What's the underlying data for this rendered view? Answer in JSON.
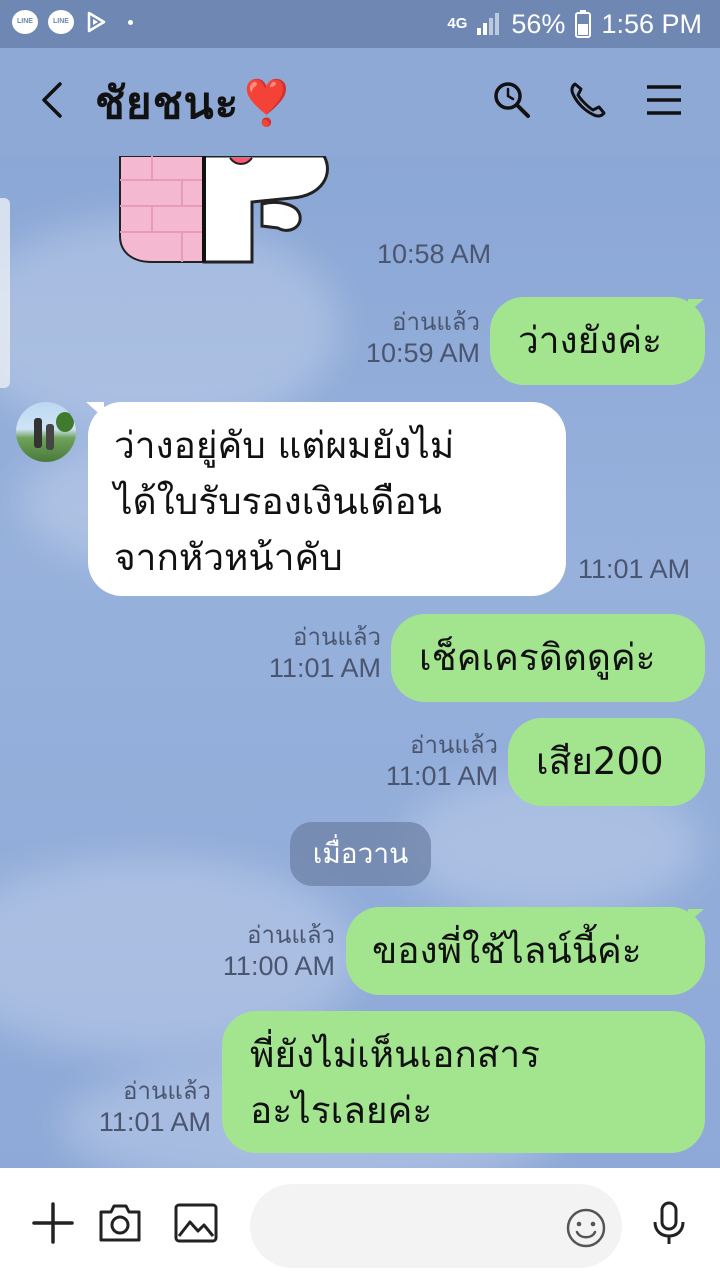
{
  "status_bar": {
    "network": "4G",
    "battery": "56%",
    "clock": "1:56 PM",
    "notif_icons": [
      "LINE",
      "LINE"
    ]
  },
  "header": {
    "title": "ชัยชนะ❣️",
    "icons": [
      "back-icon",
      "search-icon",
      "phone-icon",
      "menu-icon"
    ]
  },
  "messages": [
    {
      "side": "left",
      "type": "sticker",
      "time": "10:58 AM"
    },
    {
      "side": "right",
      "text": "ว่างยังค่ะ",
      "read": "อ่านแล้ว",
      "time": "10:59 AM"
    },
    {
      "side": "left",
      "lines": [
        "ว่างอยู่คับ แต่ผมยังไม่",
        "ได้ใบรับรองเงินเดือน",
        "จากหัวหน้าคับ"
      ],
      "time": "11:01 AM"
    },
    {
      "side": "right",
      "text": "เช็คเครดิตดูค่ะ",
      "read": "อ่านแล้ว",
      "time": "11:01 AM"
    },
    {
      "side": "right",
      "text": "เสีย200",
      "read": "อ่านแล้ว",
      "time": "11:01 AM"
    },
    {
      "side": "right",
      "text": "ของพี่ใช้ไลน์นี้ค่ะ",
      "read": "อ่านแล้ว",
      "time": "11:00 AM"
    },
    {
      "side": "right",
      "lines": [
        "พี่ยังไม่เห็นเอกสาร",
        "อะไรเลยค่ะ"
      ],
      "read": "อ่านแล้ว",
      "time": "11:01 AM"
    }
  ],
  "date_separator": "เมื่อวาน",
  "input_bar": {
    "icons": [
      "plus-icon",
      "camera-icon",
      "image-icon",
      "emoji-icon",
      "mic-icon"
    ]
  },
  "colors": {
    "chat_bg": "#8fa9d6",
    "outgoing": "#a3e58f",
    "incoming": "#ffffff"
  }
}
